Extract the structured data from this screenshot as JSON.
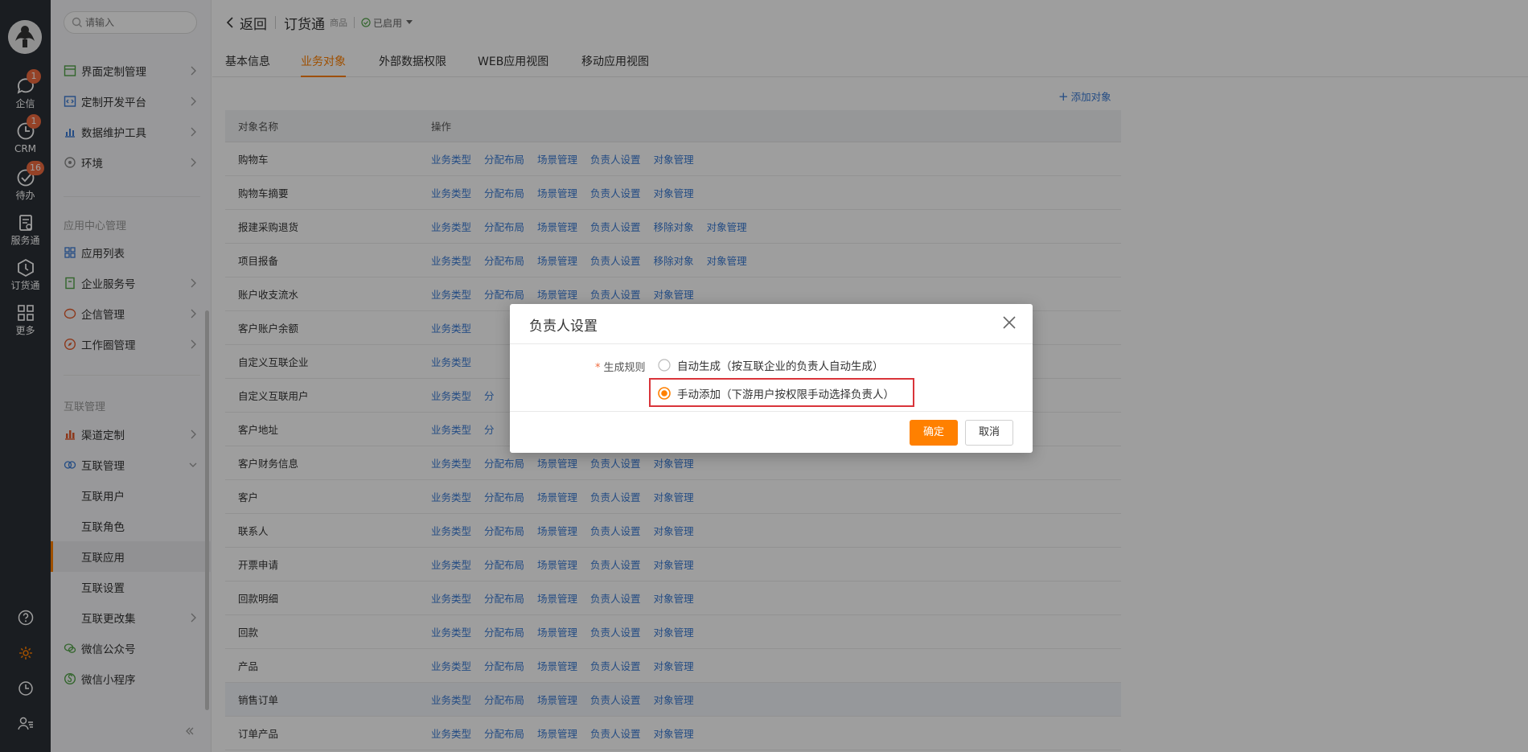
{
  "rail": {
    "items": [
      {
        "label": "企信",
        "badge": "1"
      },
      {
        "label": "CRM",
        "badge": "1"
      },
      {
        "label": "待办",
        "badge": "16"
      },
      {
        "label": "服务通",
        "badge": ""
      },
      {
        "label": "订货通",
        "badge": ""
      },
      {
        "label": "更多",
        "badge": ""
      }
    ]
  },
  "sidebar": {
    "search_placeholder": "请输入",
    "group1": [
      {
        "label": "界面定制管理"
      },
      {
        "label": "定制开发平台"
      },
      {
        "label": "数据维护工具"
      },
      {
        "label": "环境"
      }
    ],
    "section_app": "应用中心管理",
    "group2": [
      {
        "label": "应用列表"
      },
      {
        "label": "企业服务号"
      },
      {
        "label": "企信管理"
      },
      {
        "label": "工作圈管理"
      }
    ],
    "section_link": "互联管理",
    "group3": [
      {
        "label": "渠道定制"
      },
      {
        "label": "互联管理"
      }
    ],
    "sub_items": [
      {
        "label": "互联用户"
      },
      {
        "label": "互联角色"
      },
      {
        "label": "互联应用"
      },
      {
        "label": "互联设置"
      },
      {
        "label": "互联更改集"
      }
    ],
    "group4": [
      {
        "label": "微信公众号"
      },
      {
        "label": "微信小程序"
      }
    ]
  },
  "topbar": {
    "back_label": "返回",
    "app_name": "订货通",
    "app_sub": "商品",
    "status": "已启用"
  },
  "tabs": [
    "基本信息",
    "业务对象",
    "外部数据权限",
    "WEB应用视图",
    "移动应用视图"
  ],
  "add_object_label": "添加对象",
  "table": {
    "headers": [
      "对象名称",
      "操作"
    ],
    "rows": [
      {
        "name": "购物车",
        "ops": [
          "业务类型",
          "分配布局",
          "场景管理",
          "负责人设置",
          "对象管理"
        ]
      },
      {
        "name": "购物车摘要",
        "ops": [
          "业务类型",
          "分配布局",
          "场景管理",
          "负责人设置",
          "对象管理"
        ]
      },
      {
        "name": "报建采购退货",
        "ops": [
          "业务类型",
          "分配布局",
          "场景管理",
          "负责人设置",
          "移除对象",
          "对象管理"
        ]
      },
      {
        "name": "项目报备",
        "ops": [
          "业务类型",
          "分配布局",
          "场景管理",
          "负责人设置",
          "移除对象",
          "对象管理"
        ]
      },
      {
        "name": "账户收支流水",
        "ops": [
          "业务类型",
          "分配布局",
          "场景管理",
          "负责人设置",
          "对象管理"
        ]
      },
      {
        "name": "客户账户余额",
        "ops": [
          "业务类型"
        ]
      },
      {
        "name": "自定义互联企业",
        "ops": [
          "业务类型"
        ]
      },
      {
        "name": "自定义互联用户",
        "ops": [
          "业务类型",
          "分"
        ]
      },
      {
        "name": "客户地址",
        "ops": [
          "业务类型",
          "分"
        ]
      },
      {
        "name": "客户财务信息",
        "ops": [
          "业务类型",
          "分配布局",
          "场景管理",
          "负责人设置",
          "对象管理"
        ]
      },
      {
        "name": "客户",
        "ops": [
          "业务类型",
          "分配布局",
          "场景管理",
          "负责人设置",
          "对象管理"
        ]
      },
      {
        "name": "联系人",
        "ops": [
          "业务类型",
          "分配布局",
          "场景管理",
          "负责人设置",
          "对象管理"
        ]
      },
      {
        "name": "开票申请",
        "ops": [
          "业务类型",
          "分配布局",
          "场景管理",
          "负责人设置",
          "对象管理"
        ]
      },
      {
        "name": "回款明细",
        "ops": [
          "业务类型",
          "分配布局",
          "场景管理",
          "负责人设置",
          "对象管理"
        ]
      },
      {
        "name": "回款",
        "ops": [
          "业务类型",
          "分配布局",
          "场景管理",
          "负责人设置",
          "对象管理"
        ]
      },
      {
        "name": "产品",
        "ops": [
          "业务类型",
          "分配布局",
          "场景管理",
          "负责人设置",
          "对象管理"
        ]
      },
      {
        "name": "销售订单",
        "ops": [
          "业务类型",
          "分配布局",
          "场景管理",
          "负责人设置",
          "对象管理"
        ],
        "highlight": true
      },
      {
        "name": "订单产品",
        "ops": [
          "业务类型",
          "分配布局",
          "场景管理",
          "负责人设置",
          "对象管理"
        ]
      }
    ]
  },
  "modal": {
    "title": "负责人设置",
    "field_label": "生成规则",
    "required_mark": "*",
    "options": [
      {
        "label": "自动生成（按互联企业的负责人自动生成）",
        "selected": false
      },
      {
        "label": "手动添加（下游用户按权限手动选择负责人）",
        "selected": true
      }
    ],
    "ok_label": "确定",
    "cancel_label": "取消"
  },
  "colors": {
    "accent": "#ff8000",
    "link": "#3a7bd5",
    "highlight_border": "#d9343a",
    "badge": "#f06b3f",
    "rail_bg": "#2b2f36"
  }
}
